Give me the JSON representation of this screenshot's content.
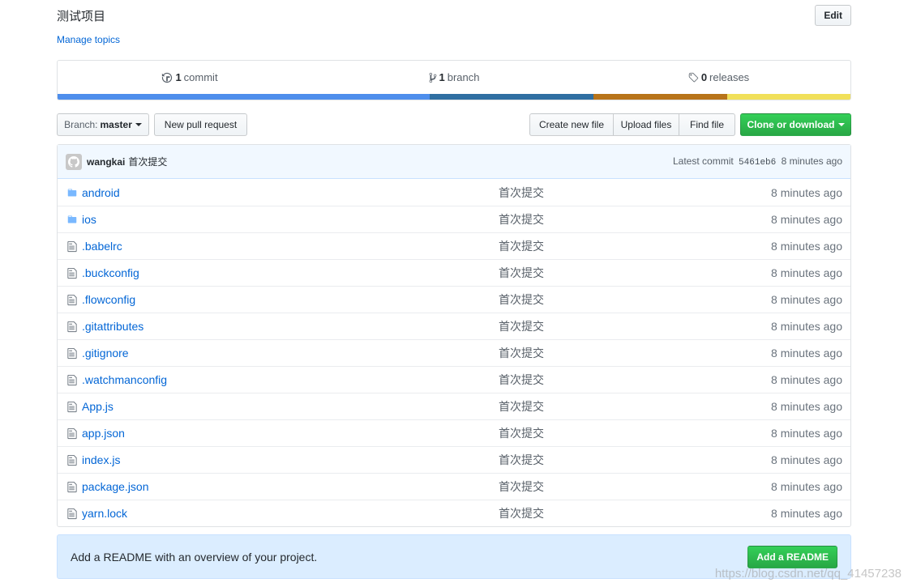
{
  "repo": {
    "description": "测试项目",
    "manage_topics": "Manage topics",
    "edit_label": "Edit"
  },
  "numbers": {
    "commits": {
      "count": "1",
      "label": "commit"
    },
    "branches": {
      "count": "1",
      "label": "branch"
    },
    "releases": {
      "count": "0",
      "label": "releases"
    }
  },
  "language_colors": [
    "#4e8eec",
    "#2f6fa2",
    "#b8741a",
    "#f1e05a"
  ],
  "toolbar": {
    "branch_prefix": "Branch:",
    "branch_name": "master",
    "new_pull_request": "New pull request",
    "create_new_file": "Create new file",
    "upload_files": "Upload files",
    "find_file": "Find file",
    "clone_or_download": "Clone or download"
  },
  "commit": {
    "author": "wangkai",
    "message": "首次提交",
    "latest_label": "Latest commit",
    "sha": "5461eb6",
    "age": "8 minutes ago"
  },
  "files": [
    {
      "name": "android",
      "type": "folder",
      "message": "首次提交",
      "age": "8 minutes ago"
    },
    {
      "name": "ios",
      "type": "folder",
      "message": "首次提交",
      "age": "8 minutes ago"
    },
    {
      "name": ".babelrc",
      "type": "file",
      "message": "首次提交",
      "age": "8 minutes ago"
    },
    {
      "name": ".buckconfig",
      "type": "file",
      "message": "首次提交",
      "age": "8 minutes ago"
    },
    {
      "name": ".flowconfig",
      "type": "file",
      "message": "首次提交",
      "age": "8 minutes ago"
    },
    {
      "name": ".gitattributes",
      "type": "file",
      "message": "首次提交",
      "age": "8 minutes ago"
    },
    {
      "name": ".gitignore",
      "type": "file",
      "message": "首次提交",
      "age": "8 minutes ago"
    },
    {
      "name": ".watchmanconfig",
      "type": "file",
      "message": "首次提交",
      "age": "8 minutes ago"
    },
    {
      "name": "App.js",
      "type": "file",
      "message": "首次提交",
      "age": "8 minutes ago"
    },
    {
      "name": "app.json",
      "type": "file",
      "message": "首次提交",
      "age": "8 minutes ago"
    },
    {
      "name": "index.js",
      "type": "file",
      "message": "首次提交",
      "age": "8 minutes ago"
    },
    {
      "name": "package.json",
      "type": "file",
      "message": "首次提交",
      "age": "8 minutes ago"
    },
    {
      "name": "yarn.lock",
      "type": "file",
      "message": "首次提交",
      "age": "8 minutes ago"
    }
  ],
  "readme": {
    "prompt": "Add a README with an overview of your project.",
    "button": "Add a README"
  },
  "watermark": "https://blog.csdn.net/qq_41457238"
}
